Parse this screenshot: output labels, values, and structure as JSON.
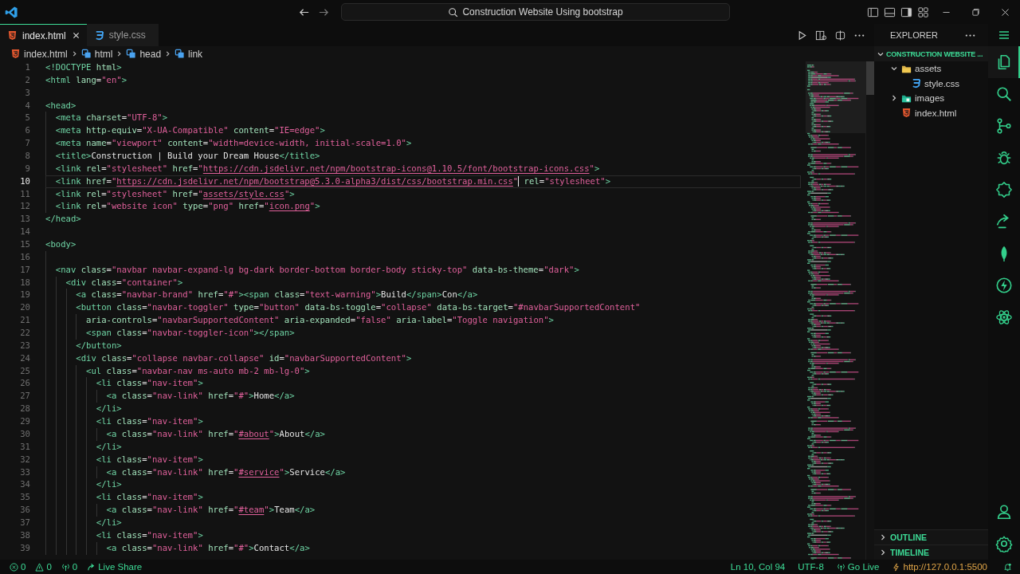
{
  "window": {
    "title": "Construction Website Using bootstrap"
  },
  "tabs": [
    {
      "label": "index.html",
      "kind": "html",
      "selected": true
    },
    {
      "label": "style.css",
      "kind": "css",
      "selected": false
    }
  ],
  "breadcrumb": [
    {
      "kind": "html",
      "text": "index.html"
    },
    {
      "kind": "element",
      "text": "html"
    },
    {
      "kind": "element",
      "text": "head"
    },
    {
      "kind": "element",
      "text": "link"
    }
  ],
  "editor": {
    "lines": [
      {
        "number": "1",
        "current": false,
        "segments": [
          {
            "kind": "code",
            "text": "<!DOCTYPE html>"
          }
        ]
      },
      {
        "number": "2",
        "current": false,
        "segments": [
          {
            "kind": "code",
            "text": "<html lang=\"en\">"
          }
        ]
      },
      {
        "number": "3",
        "current": false
      },
      {
        "number": "4",
        "current": false,
        "segments": [
          {
            "kind": "code",
            "text": "<head>"
          }
        ]
      },
      {
        "number": "5",
        "current": false,
        "segments": [
          {
            "kind": "code",
            "text": "  <meta charset=\"UTF-8\">"
          }
        ]
      },
      {
        "number": "6",
        "current": false,
        "segments": [
          {
            "kind": "code",
            "text": "  <meta http-equiv=\"X-UA-Compatible\" content=\"IE=edge\">"
          }
        ]
      },
      {
        "number": "7",
        "current": false,
        "segments": [
          {
            "kind": "code",
            "text": "  <meta name=\"viewport\" content=\"width=device-width, initial-scale=1.0\">"
          }
        ]
      },
      {
        "number": "8",
        "current": false,
        "segments": [
          {
            "kind": "code",
            "text": "  <title>Construction | Build your Dream House</title>"
          }
        ]
      },
      {
        "number": "9",
        "current": false,
        "segments": [
          {
            "kind": "code",
            "text": "  <link rel=\"stylesheet\" href=\""
          },
          {
            "kind": "link",
            "text": "https://cdn.jsdelivr.net/npm/bootstrap-icons@1.10.5/font/bootstrap-icons.css"
          },
          {
            "kind": "code",
            "text": "\">"
          }
        ]
      },
      {
        "number": "10",
        "current": true,
        "segments": [
          {
            "kind": "code",
            "text": "  <link href=\""
          },
          {
            "kind": "link",
            "text": "https://cdn.jsdelivr.net/npm/bootstrap@5.3.0-alpha3/dist/css/bootstrap.min.css"
          },
          {
            "kind": "code",
            "text": "\""
          },
          {
            "kind": "cursor"
          },
          {
            "kind": "code",
            "text": " rel=\"stylesheet\">"
          }
        ]
      },
      {
        "number": "11",
        "current": false,
        "segments": [
          {
            "kind": "code",
            "text": "  <link rel=\"stylesheet\" href=\""
          },
          {
            "kind": "link",
            "text": "assets/style.css"
          },
          {
            "kind": "code",
            "text": "\">"
          }
        ]
      },
      {
        "number": "12",
        "current": false,
        "segments": [
          {
            "kind": "code",
            "text": "  <link rel=\"website icon\" type=\"png\" href=\""
          },
          {
            "kind": "link",
            "text": "icon.png"
          },
          {
            "kind": "code",
            "text": "\">"
          }
        ]
      },
      {
        "number": "13",
        "current": false,
        "segments": [
          {
            "kind": "code",
            "text": "</head>"
          }
        ]
      },
      {
        "number": "14",
        "current": false
      },
      {
        "number": "15",
        "current": false,
        "segments": [
          {
            "kind": "code",
            "text": "<body>"
          }
        ]
      },
      {
        "number": "16",
        "current": false
      },
      {
        "number": "17",
        "current": false,
        "segments": [
          {
            "kind": "code",
            "text": "  <nav class=\"navbar navbar-expand-lg bg-dark border-bottom border-body sticky-top\" data-bs-theme=\"dark\">"
          }
        ]
      },
      {
        "number": "18",
        "current": false,
        "segments": [
          {
            "kind": "code",
            "text": "    <div class=\"container\">"
          }
        ]
      },
      {
        "number": "19",
        "current": false,
        "segments": [
          {
            "kind": "code",
            "text": "      <a class=\"navbar-brand\" href=\"#\"><span class=\"text-warning\">Build</span>Con</a>"
          }
        ]
      },
      {
        "number": "20",
        "current": false,
        "segments": [
          {
            "kind": "code",
            "text": "      <button class=\"navbar-toggler\" type=\"button\" data-bs-toggle=\"collapse\" data-bs-target=\"#navbarSupportedContent\""
          }
        ]
      },
      {
        "number": "21",
        "current": false,
        "segments": [
          {
            "kind": "code",
            "text": "        aria-controls=\"navbarSupportedContent\" aria-expanded=\"false\" aria-label=\"Toggle navigation\">"
          }
        ]
      },
      {
        "number": "22",
        "current": false,
        "segments": [
          {
            "kind": "code",
            "text": "        <span class=\"navbar-toggler-icon\"></span>"
          }
        ]
      },
      {
        "number": "23",
        "current": false,
        "segments": [
          {
            "kind": "code",
            "text": "      </button>"
          }
        ]
      },
      {
        "number": "24",
        "current": false,
        "segments": [
          {
            "kind": "code",
            "text": "      <div class=\"collapse navbar-collapse\" id=\"navbarSupportedContent\">"
          }
        ]
      },
      {
        "number": "25",
        "current": false,
        "segments": [
          {
            "kind": "code",
            "text": "        <ul class=\"navbar-nav ms-auto mb-2 mb-lg-0\">"
          }
        ]
      },
      {
        "number": "26",
        "current": false,
        "segments": [
          {
            "kind": "code",
            "text": "          <li class=\"nav-item\">"
          }
        ]
      },
      {
        "number": "27",
        "current": false,
        "segments": [
          {
            "kind": "code",
            "text": "            <a class=\"nav-link\" href=\"#\">Home</a>"
          }
        ]
      },
      {
        "number": "28",
        "current": false,
        "segments": [
          {
            "kind": "code",
            "text": "          </li>"
          }
        ]
      },
      {
        "number": "29",
        "current": false,
        "segments": [
          {
            "kind": "code",
            "text": "          <li class=\"nav-item\">"
          }
        ]
      },
      {
        "number": "30",
        "current": false,
        "segments": [
          {
            "kind": "code",
            "text": "            <a class=\"nav-link\" href=\""
          },
          {
            "kind": "link",
            "text": "#about"
          },
          {
            "kind": "code",
            "text": "\">About</a>"
          }
        ]
      },
      {
        "number": "31",
        "current": false,
        "segments": [
          {
            "kind": "code",
            "text": "          </li>"
          }
        ]
      },
      {
        "number": "32",
        "current": false,
        "segments": [
          {
            "kind": "code",
            "text": "          <li class=\"nav-item\">"
          }
        ]
      },
      {
        "number": "33",
        "current": false,
        "segments": [
          {
            "kind": "code",
            "text": "            <a class=\"nav-link\" href=\""
          },
          {
            "kind": "link",
            "text": "#service"
          },
          {
            "kind": "code",
            "text": "\">Service</a>"
          }
        ]
      },
      {
        "number": "34",
        "current": false,
        "segments": [
          {
            "kind": "code",
            "text": "          </li>"
          }
        ]
      },
      {
        "number": "35",
        "current": false,
        "segments": [
          {
            "kind": "code",
            "text": "          <li class=\"nav-item\">"
          }
        ]
      },
      {
        "number": "36",
        "current": false,
        "segments": [
          {
            "kind": "code",
            "text": "            <a class=\"nav-link\" href=\""
          },
          {
            "kind": "link",
            "text": "#team"
          },
          {
            "kind": "code",
            "text": "\">Team</a>"
          }
        ]
      },
      {
        "number": "37",
        "current": false,
        "segments": [
          {
            "kind": "code",
            "text": "          </li>"
          }
        ]
      },
      {
        "number": "38",
        "current": false,
        "segments": [
          {
            "kind": "code",
            "text": "          <li class=\"nav-item\">"
          }
        ]
      },
      {
        "number": "39",
        "current": false,
        "segments": [
          {
            "kind": "code",
            "text": "            <a class=\"nav-link\" href=\"#\">Contact</a>"
          }
        ]
      }
    ]
  },
  "sidebar": {
    "title": "EXPLORER",
    "project": {
      "label": "CONSTRUCTION WEBSITE ...",
      "expanded": true,
      "children": [
        {
          "label": "assets",
          "kind": "folder",
          "expanded": true,
          "children": [
            {
              "label": "style.css",
              "kind": "css"
            }
          ]
        },
        {
          "label": "images",
          "kind": "image-folder",
          "expanded": false
        },
        {
          "label": "index.html",
          "kind": "html"
        }
      ]
    },
    "sections": [
      {
        "label": "OUTLINE",
        "expanded": false
      },
      {
        "label": "TIMELINE",
        "expanded": false
      }
    ]
  },
  "activity_bar": [
    {
      "kind": "explorer",
      "selected": true
    },
    {
      "kind": "search",
      "selected": false
    },
    {
      "kind": "source-control",
      "selected": false
    },
    {
      "kind": "debug",
      "selected": false
    },
    {
      "kind": "extensions",
      "selected": false
    },
    {
      "kind": "remote",
      "selected": false
    },
    {
      "kind": "leaf",
      "selected": false
    },
    {
      "kind": "bolt",
      "selected": false
    },
    {
      "kind": "atom",
      "selected": false
    }
  ],
  "status_bar": {
    "left": [
      {
        "kind": "errors",
        "text": "0"
      },
      {
        "kind": "warnings",
        "text": "0"
      },
      {
        "kind": "ports",
        "text": "0"
      },
      {
        "kind": "liveshare",
        "text": "Live Share"
      }
    ],
    "right": [
      {
        "kind": "position",
        "text": "Ln 10, Col 94"
      },
      {
        "kind": "plain",
        "text": "UTF-8"
      },
      {
        "kind": "golive",
        "text": "Go Live"
      },
      {
        "kind": "server",
        "text": "http://127.0.0.1:5500"
      },
      {
        "kind": "bell"
      }
    ]
  }
}
